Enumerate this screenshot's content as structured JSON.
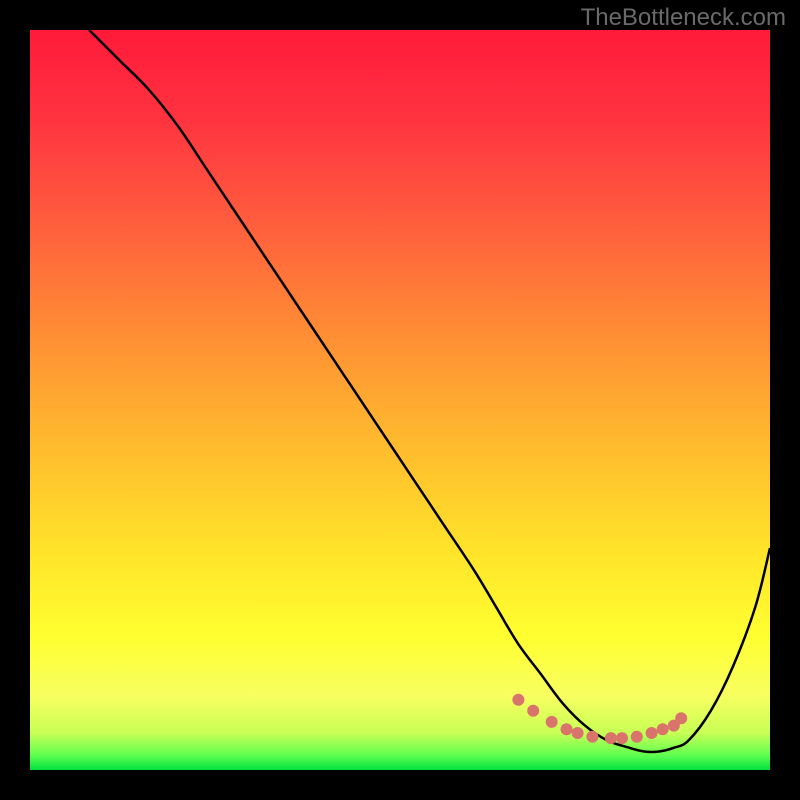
{
  "attribution": "TheBottleneck.com",
  "chart_data": {
    "type": "line",
    "title": "",
    "xlabel": "",
    "ylabel": "",
    "xlim": [
      0,
      100
    ],
    "ylim": [
      0,
      100
    ],
    "series": [
      {
        "name": "bottleneck-curve",
        "x": [
          8,
          12,
          16,
          20,
          24,
          28,
          32,
          36,
          40,
          44,
          48,
          52,
          56,
          60,
          63,
          66,
          69,
          72,
          75,
          78,
          81,
          83,
          85,
          87,
          89,
          92,
          95,
          98,
          100
        ],
        "y": [
          100,
          96,
          92,
          87,
          81,
          75,
          69,
          63,
          57,
          51,
          45,
          39,
          33,
          27,
          22,
          17,
          13,
          9,
          6,
          4,
          3,
          2.5,
          2.5,
          3,
          4,
          8,
          14,
          22,
          30
        ]
      }
    ],
    "markers": {
      "name": "optimal-range-dots",
      "color": "#d9746c",
      "x": [
        66,
        68,
        70.5,
        72.5,
        74,
        76,
        78.5,
        80,
        82,
        84,
        85.5,
        87,
        88
      ],
      "y": [
        9.5,
        8,
        6.5,
        5.5,
        5,
        4.5,
        4.3,
        4.3,
        4.5,
        5,
        5.5,
        6,
        7
      ]
    },
    "gradient_stops": [
      {
        "offset": 0.0,
        "color": "#ff1a3a"
      },
      {
        "offset": 0.12,
        "color": "#ff3340"
      },
      {
        "offset": 0.25,
        "color": "#ff5a3e"
      },
      {
        "offset": 0.4,
        "color": "#ff8a35"
      },
      {
        "offset": 0.55,
        "color": "#ffb82e"
      },
      {
        "offset": 0.7,
        "color": "#ffe22a"
      },
      {
        "offset": 0.82,
        "color": "#ffff30"
      },
      {
        "offset": 0.9,
        "color": "#f7ff60"
      },
      {
        "offset": 0.95,
        "color": "#c8ff55"
      },
      {
        "offset": 0.98,
        "color": "#60ff50"
      },
      {
        "offset": 1.0,
        "color": "#00e040"
      }
    ]
  }
}
